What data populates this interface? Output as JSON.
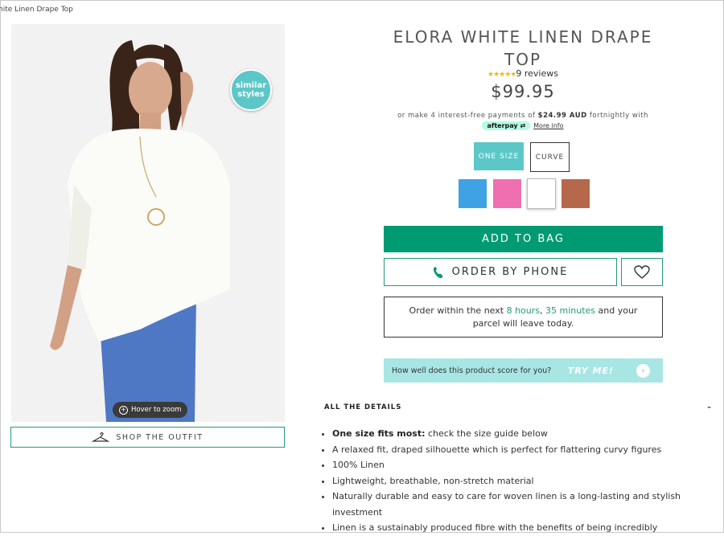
{
  "breadcrumb": "hite Linen Drape Top",
  "product": {
    "title": "ELORA WHITE LINEN DRAPE TOP",
    "rating_stars": "★★★★★",
    "rating": 5,
    "reviews": "9 reviews",
    "price": "$99.95"
  },
  "image": {
    "similar_line1": "similar",
    "similar_line2": "styles",
    "zoom_label": "Hover to zoom",
    "shop_outfit": "SHOP THE OUTFIT"
  },
  "payment": {
    "prefix": "or make 4 interest-free payments of ",
    "amount": "$24.99 AUD",
    "suffix": " fortnightly with",
    "provider": "afterpay",
    "more_info": "More info"
  },
  "sizes": [
    {
      "label": "ONE SIZE",
      "selected": true
    },
    {
      "label": "CURVE",
      "selected": false
    }
  ],
  "swatches": [
    {
      "color": "#3fa2e2"
    },
    {
      "color": "#ef6fb0"
    },
    {
      "color": "#ffffff",
      "selected": true
    },
    {
      "color": "#b5684a"
    }
  ],
  "actions": {
    "add_to_bag": "ADD TO BAG",
    "order_by_phone": "ORDER BY PHONE"
  },
  "shipping": {
    "line1_prefix": "Order within the next ",
    "hours": "8 hours",
    "sep": ", ",
    "minutes": "35 minutes",
    "line1_suffix": " and your",
    "line2": "parcel will leave today."
  },
  "score": {
    "question": "How well does this product score for you?",
    "cta": "TRY ME!"
  },
  "details": {
    "heading": "ALL THE DETAILS",
    "toggle": "-",
    "first_bold": "One size fits most:",
    "first_rest": " check the size guide below",
    "items": [
      "A relaxed fit, draped silhouette which is perfect for flattering curvy figures",
      "100% Linen",
      "Lightweight, breathable, non-stretch material",
      "Naturally durable and easy to care for woven linen is a long-lasting and stylish investment",
      "Linen is a sustainably produced fibre with the benefits of being incredibly"
    ]
  },
  "colors": {
    "teal": "#5cc7c7",
    "green": "#009a73",
    "border_green": "#1f9a7a",
    "score_bg": "#a8e6e4"
  }
}
